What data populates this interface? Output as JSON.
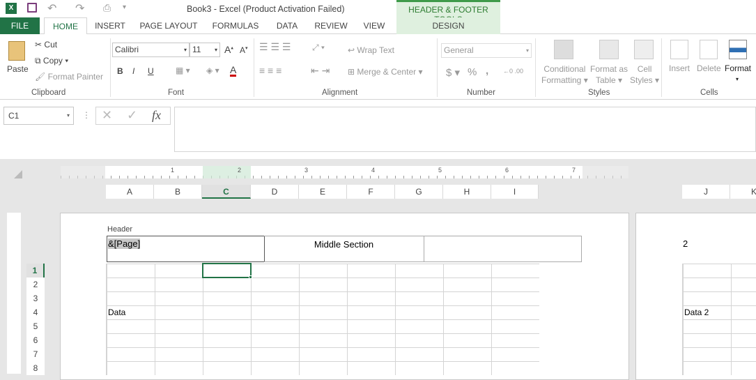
{
  "title": "Book3 - Excel (Product Activation Failed)",
  "contextual_tab_group": "HEADER & FOOTER TOOLS",
  "tabs": [
    {
      "label": "FILE"
    },
    {
      "label": "HOME"
    },
    {
      "label": "INSERT"
    },
    {
      "label": "PAGE LAYOUT"
    },
    {
      "label": "FORMULAS"
    },
    {
      "label": "DATA"
    },
    {
      "label": "REVIEW"
    },
    {
      "label": "VIEW"
    },
    {
      "label": "DESIGN"
    }
  ],
  "active_tab": "HOME",
  "accent": "#217346",
  "ribbon": {
    "clipboard": {
      "label": "Clipboard",
      "paste": "Paste",
      "cut": "Cut",
      "copy": "Copy",
      "format_painter": "Format Painter"
    },
    "font": {
      "label": "Font",
      "font_name": "Calibri",
      "font_size": "11",
      "bold": "B",
      "italic": "I",
      "underline": "U"
    },
    "alignment": {
      "label": "Alignment",
      "wrap_text": "Wrap Text",
      "merge_center": "Merge & Center"
    },
    "number": {
      "label": "Number",
      "format": "General",
      "currency": "$",
      "percent": "%",
      "comma": ","
    },
    "styles": {
      "label": "Styles",
      "conditional_formatting": [
        "Conditional",
        "Formatting"
      ],
      "format_as_table": [
        "Format as",
        "Table"
      ],
      "cell_styles": [
        "Cell",
        "Styles"
      ]
    },
    "cells": {
      "label": "Cells",
      "insert": "Insert",
      "delete": "Delete",
      "format": "Format"
    }
  },
  "name_box": "C1",
  "formula_fx": "fx",
  "formula_value": "",
  "ruler_ticks": [
    "1",
    "2",
    "3",
    "4",
    "5",
    "6",
    "7"
  ],
  "columns_page1": [
    "A",
    "B",
    "C",
    "D",
    "E",
    "F",
    "G",
    "H",
    "I"
  ],
  "columns_page2": [
    "J",
    "K"
  ],
  "selected_column": "C",
  "rows": [
    "1",
    "2",
    "3",
    "4",
    "5",
    "6",
    "7",
    "8"
  ],
  "selected_row": "1",
  "header": {
    "label": "Header",
    "left": "&[Page]",
    "center": "Middle Section",
    "right": ""
  },
  "page2_header": "2",
  "cells": {
    "A4": "Data",
    "J4": "Data 2"
  }
}
